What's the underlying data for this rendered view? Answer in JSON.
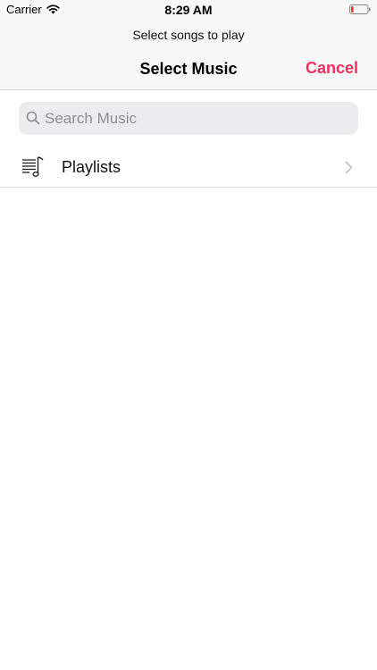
{
  "status_bar": {
    "carrier": "Carrier",
    "time": "8:29 AM",
    "icons": [
      "wifi-icon",
      "battery-icon"
    ],
    "battery_level": 0.15
  },
  "header": {
    "prompt": "Select songs to play",
    "title": "Select Music",
    "cancel_label": "Cancel"
  },
  "search": {
    "placeholder": "Search Music",
    "value": "",
    "icon": "search-icon"
  },
  "list": {
    "items": [
      {
        "label": "Playlists",
        "icon": "playlist-icon"
      }
    ]
  },
  "colors": {
    "accent": "#f2315c",
    "header_bg": "#f7f7f7",
    "search_bg": "#ececee",
    "placeholder": "#8e8e93",
    "battery_low": "#e53935"
  }
}
